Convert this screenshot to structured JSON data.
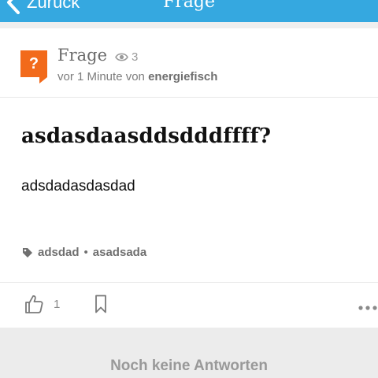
{
  "nav": {
    "back_label": "Zurück",
    "title": "Frage"
  },
  "question": {
    "category": "Frage",
    "views": "3",
    "time": "vor 1 Minute von",
    "author": "energiefisch",
    "title": "asdasdaasddsdddffff?",
    "body": "adsdadasdasdad",
    "tags": [
      "adsdad",
      "asadsada"
    ],
    "likes": "1"
  },
  "answers": {
    "empty_label": "Noch keine Antworten"
  },
  "colors": {
    "nav_bg": "#35a8e0",
    "question_icon": "#f26a1b"
  }
}
